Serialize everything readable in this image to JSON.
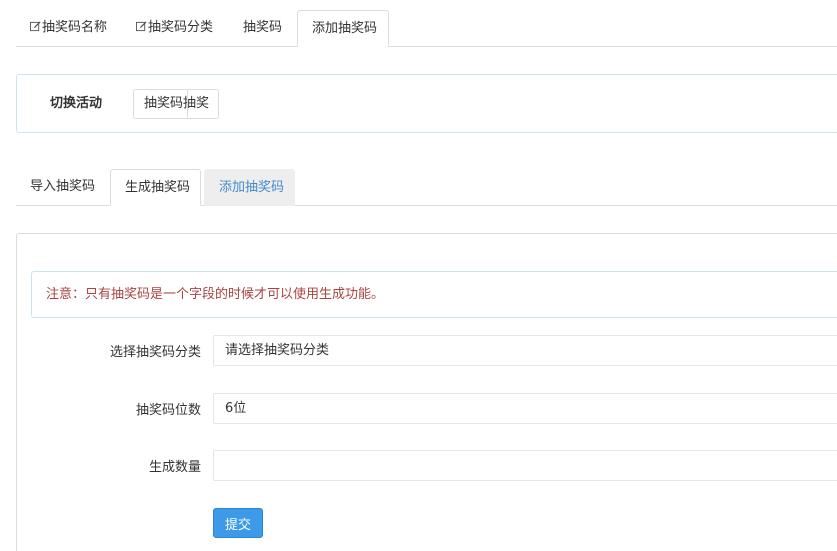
{
  "top_tabs": [
    {
      "label": "抽奖码名称",
      "icon": "edit-icon",
      "active": false
    },
    {
      "label": "抽奖码分类",
      "icon": "edit-icon",
      "active": false
    },
    {
      "label": "抽奖码",
      "icon": null,
      "active": false
    },
    {
      "label": "添加抽奖码",
      "icon": null,
      "active": true
    }
  ],
  "switch_panel": {
    "label": "切换活动",
    "button_label": "抽奖码抽奖"
  },
  "sub_tabs": [
    {
      "label": "导入抽奖码",
      "state": "normal"
    },
    {
      "label": "生成抽奖码",
      "state": "active"
    },
    {
      "label": "添加抽奖码",
      "state": "hover"
    }
  ],
  "form": {
    "notice": "注意：只有抽奖码是一个字段的时候才可以使用生成功能。",
    "category": {
      "label": "选择抽奖码分类",
      "value": "请选择抽奖码分类"
    },
    "digits": {
      "label": "抽奖码位数",
      "value": "6位"
    },
    "quantity": {
      "label": "生成数量",
      "value": ""
    },
    "submit_label": "提交"
  },
  "colors": {
    "accent": "#3c9ae8",
    "link": "#428bca",
    "notice_text": "#a94442",
    "panel_border": "#c9e6ee"
  }
}
